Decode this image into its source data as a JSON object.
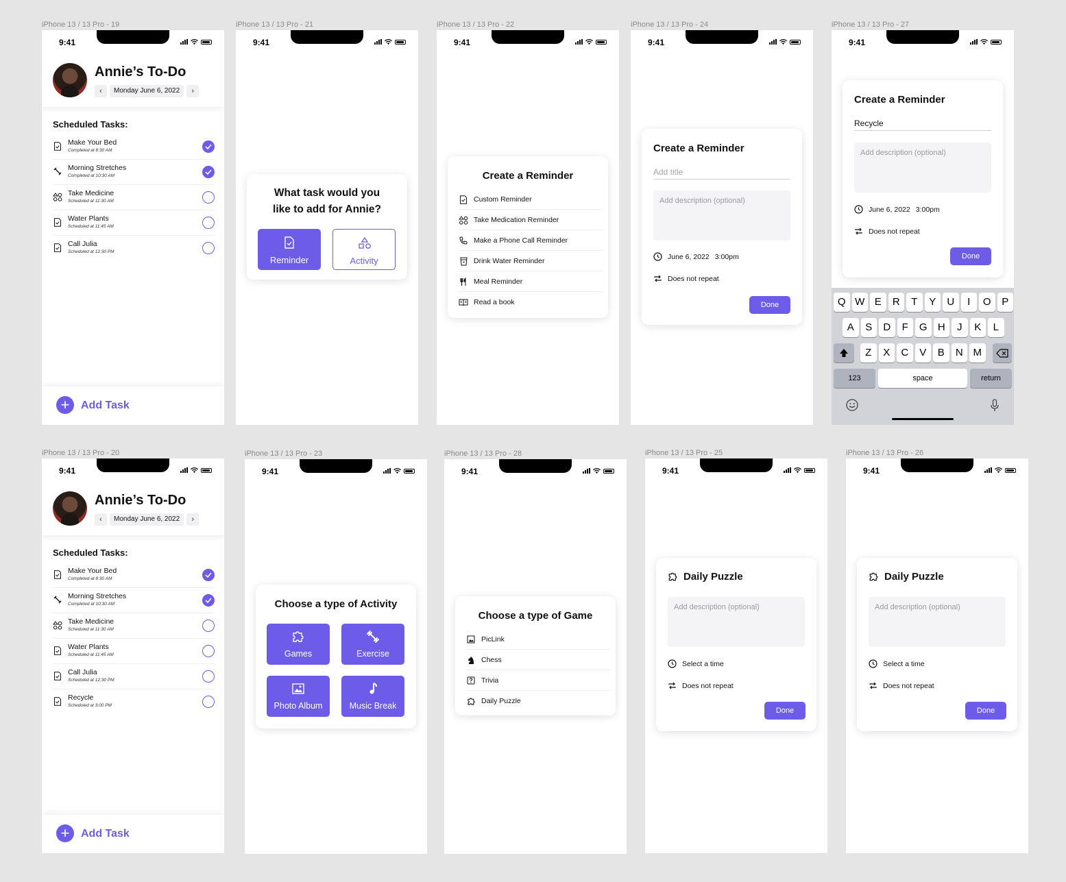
{
  "frame_labels": {
    "f19": "iPhone 13 / 13 Pro - 19",
    "f21": "iPhone 13 / 13 Pro - 21",
    "f22": "iPhone 13 / 13 Pro - 22",
    "f24": "iPhone 13 / 13 Pro - 24",
    "f27": "iPhone 13 / 13 Pro - 27",
    "f20": "iPhone 13 / 13 Pro - 20",
    "f23": "iPhone 13 / 13 Pro - 23",
    "f28": "iPhone 13 / 13 Pro - 28",
    "f25": "iPhone 13 / 13 Pro - 25",
    "f26": "iPhone 13 / 13 Pro - 26"
  },
  "status": {
    "time": "9:41"
  },
  "todo": {
    "title": "Annie’s To-Do",
    "date": "Monday June 6, 2022",
    "prev": "‹",
    "next": "›",
    "scheduled_title": "Scheduled Tasks:",
    "add_task": "Add Task",
    "add_plus": "+",
    "tasks": [
      {
        "name": "Make Your Bed",
        "sub": "Completed at 8:30 AM",
        "done": true,
        "icon": "checklist-icon"
      },
      {
        "name": "Morning Stretches",
        "sub": "Completed at 10:30 AM",
        "done": true,
        "icon": "stretch-icon"
      },
      {
        "name": "Take Medicine",
        "sub": "Scheduled at 11:30 AM",
        "done": false,
        "icon": "medication-icon"
      },
      {
        "name": "Water Plants",
        "sub": "Scheduled at 11:45 AM",
        "done": false,
        "icon": "checklist-icon"
      },
      {
        "name": "Call Julia",
        "sub": "Scheduled at 12:30 PM",
        "done": false,
        "icon": "checklist-icon"
      },
      {
        "name": "Recycle",
        "sub": "Scheduled at 3:00 PM",
        "done": false,
        "icon": "checklist-icon"
      }
    ]
  },
  "task_type": {
    "question_line1": "What task would you",
    "question_line2": "like to add for Annie?",
    "reminder": "Reminder",
    "activity": "Activity"
  },
  "reminder_menu": {
    "title": "Create a Reminder",
    "items": [
      {
        "label": "Custom Reminder",
        "icon": "checklist-icon"
      },
      {
        "label": "Take Medication Reminder",
        "icon": "medication-icon"
      },
      {
        "label": "Make a Phone Call Reminder",
        "icon": "phone-icon"
      },
      {
        "label": "Drink Water Reminder",
        "icon": "cup-icon"
      },
      {
        "label": "Meal Reminder",
        "icon": "utensils-icon"
      },
      {
        "label": "Read a book",
        "icon": "book-icon"
      }
    ]
  },
  "reminder_form": {
    "title": "Create a Reminder",
    "title_placeholder": "Add title",
    "title_value": "Recycle",
    "desc_placeholder": "Add description (optional)",
    "date": "June 6, 2022",
    "time": "3:00pm",
    "repeat": "Does not repeat",
    "done": "Done"
  },
  "keyboard": {
    "row1": [
      "Q",
      "W",
      "E",
      "R",
      "T",
      "Y",
      "U",
      "I",
      "O",
      "P"
    ],
    "row2": [
      "A",
      "S",
      "D",
      "F",
      "G",
      "H",
      "J",
      "K",
      "L"
    ],
    "row3": [
      "Z",
      "X",
      "C",
      "V",
      "B",
      "N",
      "M"
    ],
    "numbers": "123",
    "space": "space",
    "return": "return"
  },
  "activity": {
    "title": "Choose a type of Activity",
    "tiles": [
      {
        "label": "Games",
        "icon": "puzzle-icon"
      },
      {
        "label": "Exercise",
        "icon": "dumbbell-icon"
      },
      {
        "label": "Photo Album",
        "icon": "photo-icon"
      },
      {
        "label": "Music Break",
        "icon": "music-icon"
      }
    ]
  },
  "game_menu": {
    "title": "Choose a type of Game",
    "items": [
      {
        "label": "PicLink",
        "icon": "picture-icon"
      },
      {
        "label": "Chess",
        "icon": "chess-knight-icon"
      },
      {
        "label": "Trivia",
        "icon": "question-icon"
      },
      {
        "label": "Daily Puzzle",
        "icon": "puzzle-icon"
      }
    ]
  },
  "puzzle": {
    "title": "Daily Puzzle",
    "desc_placeholder": "Add description (optional)",
    "time": "Select a time",
    "repeat": "Does not repeat",
    "done": "Done"
  },
  "colors": {
    "accent": "#6c5ce7",
    "canvas": "#e5e5e5"
  }
}
